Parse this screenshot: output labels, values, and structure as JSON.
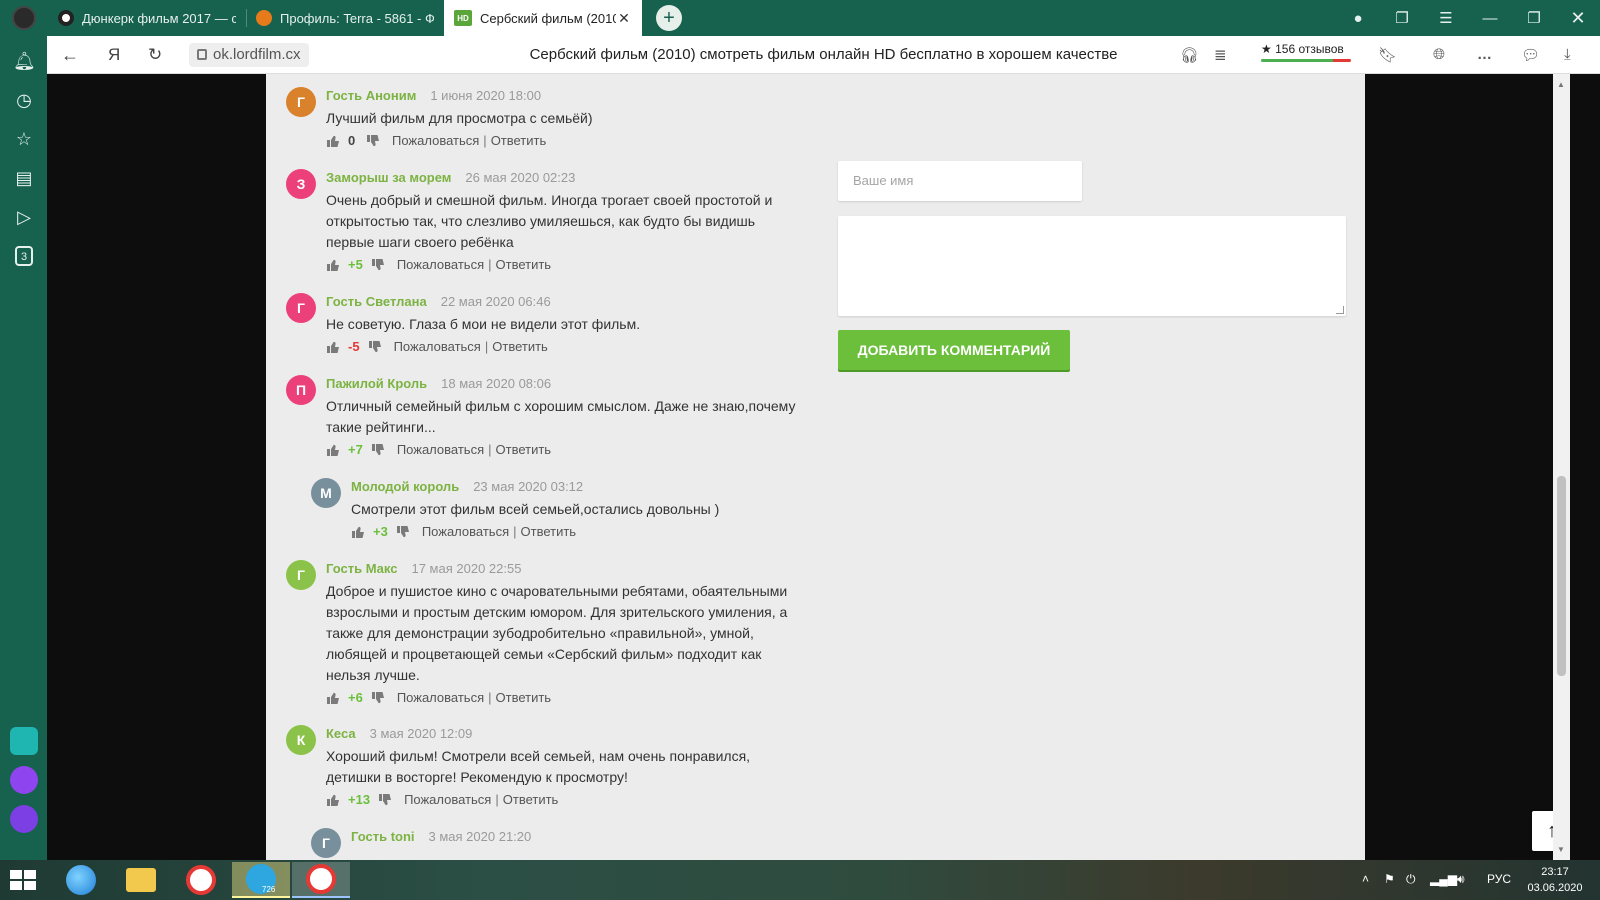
{
  "browser": {
    "tabs": [
      {
        "title": "Дюнкерк фильм 2017 — с",
        "active": false,
        "favicon": "dark-circle-icon"
      },
      {
        "title": "Профиль: Terra - 5861 - Ф",
        "active": false,
        "favicon": "orange-film-icon"
      },
      {
        "title": "Сербский фильм (2010)",
        "active": true,
        "favicon": "hd-badge-icon",
        "favicon_text": "HD"
      }
    ],
    "new_tab": "+",
    "address": {
      "url": "ok.lordfilm.cx",
      "yandex_letter": "Я",
      "page_title": "Сербский фильм (2010) смотреть фильм онлайн HD бесплатно в хорошем качестве",
      "rating_star": "★",
      "rating_text": "156 отзывов"
    }
  },
  "sidebar": {
    "counter_badge": "3"
  },
  "comments": [
    {
      "avatar_letter": "Г",
      "avatar_color": "#d9822b",
      "author": "Гость Аноним",
      "date": "1 июня 2020 18:00",
      "text": "Лучший фильм для просмотра с семьёй)",
      "votes": "0",
      "vote_kind": "zero"
    },
    {
      "avatar_letter": "З",
      "avatar_color": "#ec407a",
      "author": "Заморыш за морем",
      "date": "26 мая 2020 02:23",
      "text": "Очень добрый и смешной фильм. Иногда трогает своей простотой и открытостью так, что слезливо умиляешься, как будто бы видишь первые шаги своего ребёнка",
      "votes": "+5",
      "vote_kind": "pos"
    },
    {
      "avatar_letter": "Г",
      "avatar_color": "#ec407a",
      "author": "Гость Светлана",
      "date": "22 мая 2020 06:46",
      "text": "Не советую. Глаза б мои не видели этот фильм.",
      "votes": "-5",
      "vote_kind": "neg"
    },
    {
      "avatar_letter": "П",
      "avatar_color": "#ec407a",
      "author": "Пажилой Кроль",
      "date": "18 мая 2020 08:06",
      "text": "Отличный семейный фильм с хорошим смыслом. Даже не знаю,почему такие рейтинги...",
      "votes": "+7",
      "vote_kind": "pos"
    },
    {
      "avatar_letter": "М",
      "avatar_color": "#78909c",
      "author": "Молодой король",
      "date": "23 мая 2020 03:12",
      "text": "Смотрели этот фильм всей семьей,остались довольны )",
      "votes": "+3",
      "vote_kind": "pos"
    },
    {
      "avatar_letter": "Г",
      "avatar_color": "#8bc34a",
      "author": "Гость Макс",
      "date": "17 мая 2020 22:55",
      "text": "Доброе и пушистое кино с очаровательными ребятами, обаятельными взрослыми и простым детским юмором. Для зрительского умиления, а также для демонстрации зубодробительно «правильной», умной, любящей и процветающей семьи «Сербский фильм» подходит как нельзя лучше.",
      "votes": "+6",
      "vote_kind": "pos"
    },
    {
      "avatar_letter": "К",
      "avatar_color": "#8bc34a",
      "author": "Кеса",
      "date": "3 мая 2020 12:09",
      "text": "Хороший фильм! Смотрели всей семьей, нам очень понравился, детишки в восторге! Рекомендую к просмотру!",
      "votes": "+13",
      "vote_kind": "pos"
    },
    {
      "avatar_letter": "Г",
      "avatar_color": "#78909c",
      "author": "Гость toni",
      "date": "3 мая 2020 21:20",
      "text": "",
      "votes": "",
      "vote_kind": "zero"
    }
  ],
  "actions": {
    "report": "Пожаловаться",
    "separator": "|",
    "reply": "Ответить"
  },
  "form": {
    "name_placeholder": "Ваше имя",
    "submit_label": "ДОБАВИТЬ КОММЕНТАРИЙ"
  },
  "taskbar": {
    "telegram_badge": "726",
    "language": "РУС",
    "time": "23:17",
    "date": "03.06.2020"
  },
  "colors": {
    "browser_green": "#17624f",
    "accent_green": "#6bbf3b",
    "author_green": "#7cb342",
    "negative_red": "#e53935"
  }
}
